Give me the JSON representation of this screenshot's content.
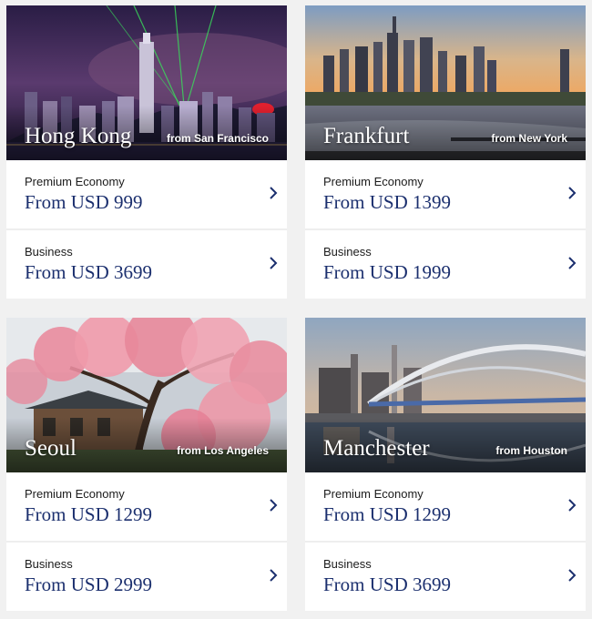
{
  "cards": [
    {
      "city": "Hong Kong",
      "origin": "from San Francisco",
      "fares": [
        {
          "cabin": "Premium Economy",
          "price": "From USD 999"
        },
        {
          "cabin": "Business",
          "price": "From USD 3699"
        }
      ]
    },
    {
      "city": "Frankfurt",
      "origin": "from New York",
      "fares": [
        {
          "cabin": "Premium Economy",
          "price": "From USD 1399"
        },
        {
          "cabin": "Business",
          "price": "From USD 1999"
        }
      ]
    },
    {
      "city": "Seoul",
      "origin": "from Los Angeles",
      "fares": [
        {
          "cabin": "Premium Economy",
          "price": "From USD 1299"
        },
        {
          "cabin": "Business",
          "price": "From USD 2999"
        }
      ]
    },
    {
      "city": "Manchester",
      "origin": "from Houston",
      "fares": [
        {
          "cabin": "Premium Economy",
          "price": "From USD 1299"
        },
        {
          "cabin": "Business",
          "price": "From USD 3699"
        }
      ]
    }
  ],
  "colors": {
    "page_bg": "#f1f1f1",
    "card_bg": "#ffffff",
    "price_text": "#1b2f6e",
    "chevron": "#1b2f6e"
  },
  "icons": {
    "fare_arrow": "chevron-right-icon"
  }
}
